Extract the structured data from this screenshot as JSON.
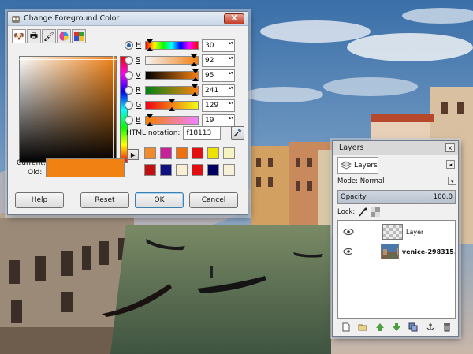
{
  "color_dialog": {
    "title": "Change Foreground Color",
    "close_label": "X",
    "channels": [
      {
        "label": "H",
        "value": "30",
        "selected": true,
        "pos": 0.08
      },
      {
        "label": "S",
        "value": "92",
        "selected": false,
        "pos": 0.92
      },
      {
        "label": "V",
        "value": "95",
        "selected": false,
        "pos": 0.95
      },
      {
        "label": "R",
        "value": "241",
        "selected": false,
        "pos": 0.945
      },
      {
        "label": "G",
        "value": "129",
        "selected": false,
        "pos": 0.506
      },
      {
        "label": "B",
        "value": "19",
        "selected": false,
        "pos": 0.075
      }
    ],
    "html_notation_label": "HTML notation:",
    "html_notation_value": "f18113",
    "current_label": "Current:",
    "old_label": "Old:",
    "current_color": "#f18113",
    "history_colors": [
      "#f08a2a",
      "#c8209a",
      "#f07010",
      "#e01010",
      "#f0e000",
      "#f8f2c0",
      "#c01010",
      "#101080",
      "#f8f0d0",
      "#e01010",
      "#000060",
      "#f8f0d8"
    ],
    "buttons": {
      "help": "Help",
      "reset": "Reset",
      "ok": "OK",
      "cancel": "Cancel"
    }
  },
  "layers_dialog": {
    "title": "Layers",
    "close_label": "x",
    "tab_label": "Layers",
    "mode_label": "Mode: Normal",
    "opacity_label": "Opacity",
    "opacity_value": "100.0",
    "lock_label": "Lock:",
    "layers": [
      {
        "name": "Layer",
        "thumb": "transparent"
      },
      {
        "name": "venice-298315.jp",
        "thumb": "photo"
      }
    ]
  }
}
